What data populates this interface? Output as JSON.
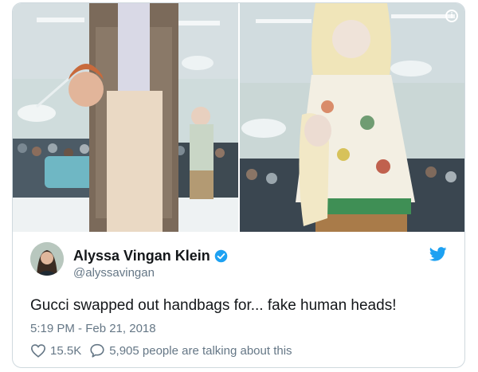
{
  "tweet": {
    "author_name": "Alyssa Vingan Klein",
    "handle": "@alyssavingan",
    "text": "Gucci swapped out handbags for... fake human heads!",
    "timestamp": "5:19 PM - Feb 21, 2018",
    "likes": "15.5K",
    "conversation": "5,905 people are talking about this",
    "info_icon_glyph": "i"
  },
  "icons": {
    "info": "info-icon",
    "verified": "verified-badge-icon",
    "bird": "twitter-bird-icon",
    "heart": "heart-icon",
    "speech": "speech-bubble-icon"
  },
  "colors": {
    "brand_blue": "#1da1f2",
    "text": "#14171a",
    "muted": "#657786",
    "border": "#cfd9de"
  }
}
